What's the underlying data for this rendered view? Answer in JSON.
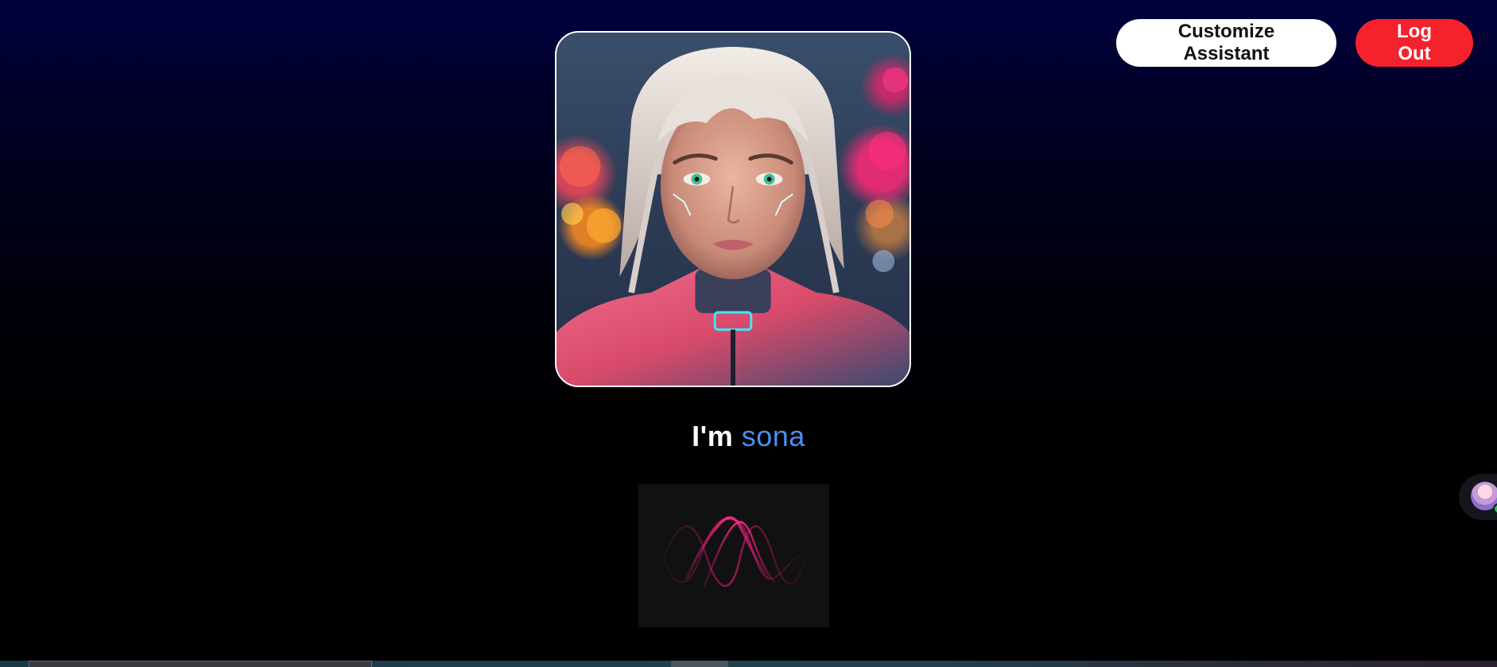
{
  "header": {
    "customize_label": "Customize Assistant",
    "logout_label": "Log Out"
  },
  "assistant": {
    "greeting": "I'm",
    "name": "sona",
    "online": true
  },
  "colors": {
    "name_accent": "#4d8ff0",
    "logout_bg": "#f5222d",
    "customize_bg": "#ffffff",
    "wave_color": "#e6197a"
  },
  "icons": {
    "chat_launcher": "assistant-avatar-icon",
    "status": "online-status-dot"
  }
}
